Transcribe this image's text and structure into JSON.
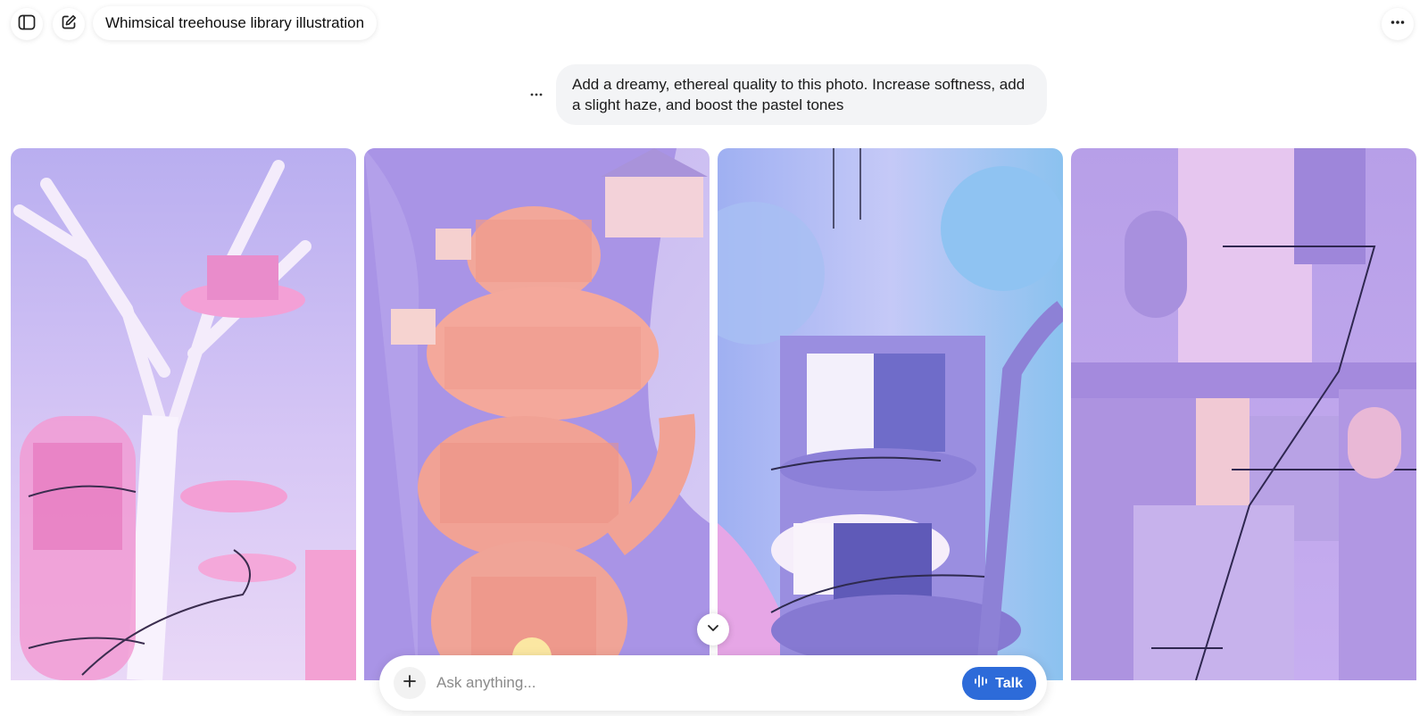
{
  "header": {
    "sidebar_toggle_icon": "sidebar-icon",
    "new_chat_icon": "edit-icon",
    "title": "Whimsical treehouse library illustration",
    "more_icon": "ellipsis-icon"
  },
  "conversation": {
    "user_message": "Add a dreamy, ethereal quality to this photo. Increase softness, add a slight haze, and boost the pastel tones",
    "message_options_icon": "ellipsis-icon"
  },
  "gallery": {
    "images": [
      {
        "name": "treehouse-image-1",
        "accent": "#f29bd4"
      },
      {
        "name": "treehouse-image-2",
        "accent": "#f4a6a0"
      },
      {
        "name": "treehouse-image-3",
        "accent": "#8fb5f0"
      },
      {
        "name": "treehouse-image-4",
        "accent": "#c9a9f2"
      }
    ]
  },
  "scroll_icon": "chevron-down-icon",
  "composer": {
    "placeholder": "Ask anything...",
    "talk_label": "Talk",
    "attach_icon": "plus-icon",
    "talk_icon": "waveform-icon"
  },
  "colors": {
    "accent": "#2d6bd9",
    "bubble": "#f3f4f6"
  }
}
